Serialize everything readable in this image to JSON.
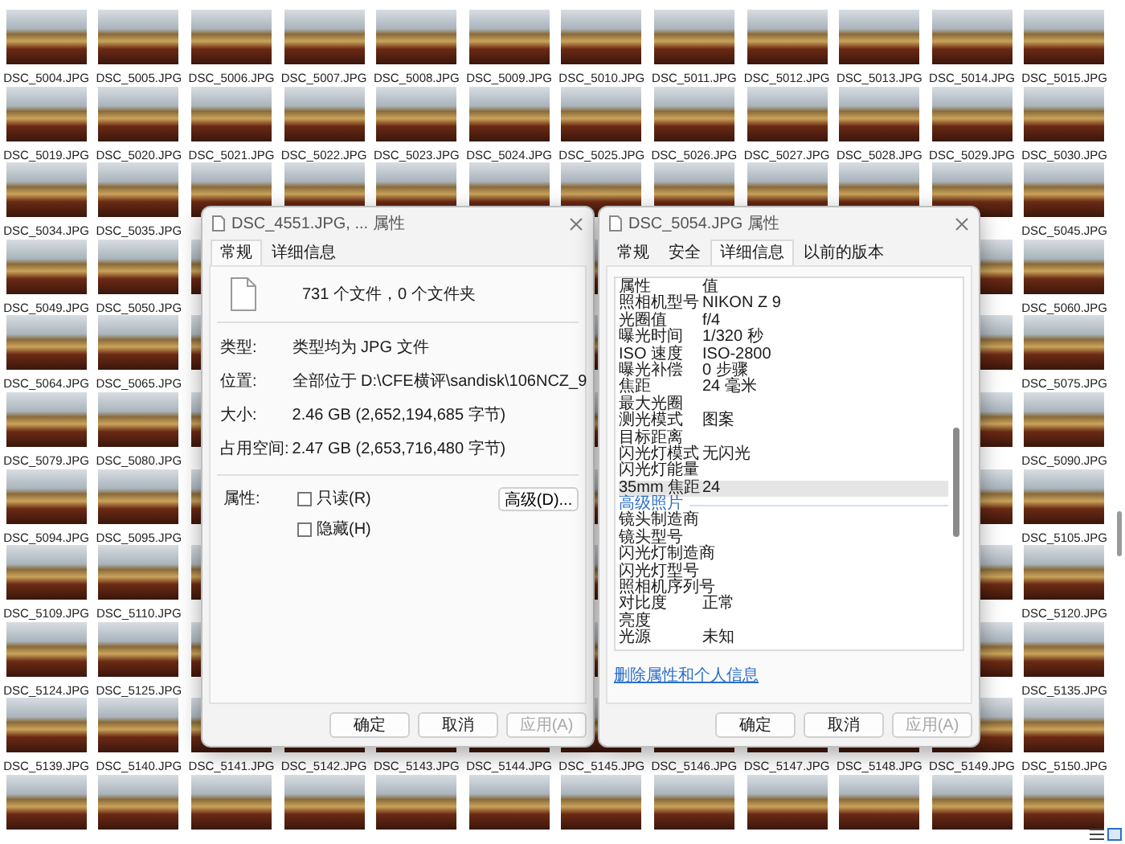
{
  "file_grid": {
    "rows": [
      [
        "DSC_5004.JPG",
        "DSC_5005.JPG",
        "DSC_5006.JPG",
        "DSC_5007.JPG",
        "DSC_5008.JPG",
        "DSC_5009.JPG",
        "DSC_5010.JPG",
        "DSC_5011.JPG",
        "DSC_5012.JPG",
        "DSC_5013.JPG",
        "DSC_5014.JPG",
        "DSC_5015.JPG"
      ],
      [
        "DSC_5019.JPG",
        "DSC_5020.JPG",
        "DSC_5021.JPG",
        "DSC_5022.JPG",
        "DSC_5023.JPG",
        "DSC_5024.JPG",
        "DSC_5025.JPG",
        "DSC_5026.JPG",
        "DSC_5027.JPG",
        "DSC_5028.JPG",
        "DSC_5029.JPG",
        "DSC_5030.JPG"
      ],
      [
        "DSC_5034.JPG",
        "DSC_5035.JPG",
        null,
        null,
        null,
        null,
        null,
        null,
        null,
        null,
        null,
        "DSC_5045.JPG"
      ],
      [
        "DSC_5049.JPG",
        "DSC_5050.JPG",
        null,
        null,
        null,
        null,
        null,
        null,
        null,
        null,
        null,
        "DSC_5060.JPG"
      ],
      [
        "DSC_5064.JPG",
        "DSC_5065.JPG",
        null,
        null,
        null,
        null,
        null,
        null,
        null,
        null,
        null,
        "DSC_5075.JPG"
      ],
      [
        "DSC_5079.JPG",
        "DSC_5080.JPG",
        null,
        null,
        null,
        null,
        null,
        null,
        null,
        null,
        null,
        "DSC_5090.JPG"
      ],
      [
        "DSC_5094.JPG",
        "DSC_5095.JPG",
        null,
        null,
        null,
        null,
        null,
        null,
        null,
        null,
        null,
        "DSC_5105.JPG"
      ],
      [
        "DSC_5109.JPG",
        "DSC_5110.JPG",
        null,
        null,
        null,
        null,
        null,
        null,
        null,
        null,
        null,
        "DSC_5120.JPG"
      ],
      [
        "DSC_5124.JPG",
        "DSC_5125.JPG",
        null,
        null,
        null,
        null,
        null,
        null,
        null,
        null,
        null,
        "DSC_5135.JPG"
      ],
      [
        "DSC_5139.JPG",
        "DSC_5140.JPG",
        "DSC_5141.JPG",
        "DSC_5142.JPG",
        "DSC_5143.JPG",
        "DSC_5144.JPG",
        "DSC_5145.JPG",
        "DSC_5146.JPG",
        "DSC_5147.JPG",
        "DSC_5148.JPG",
        "DSC_5149.JPG",
        "DSC_5150.JPG"
      ],
      [
        null,
        null,
        null,
        null,
        null,
        null,
        null,
        null,
        null,
        null,
        null,
        null
      ]
    ]
  },
  "general_dialog": {
    "title": "DSC_4551.JPG, ... 属性",
    "tabs": [
      {
        "label": "常规",
        "selected": true
      },
      {
        "label": "详细信息",
        "selected": false
      }
    ],
    "summary": "731 个文件，0 个文件夹",
    "fields": [
      {
        "label": "类型:",
        "value": "类型均为 JPG 文件"
      },
      {
        "label": "位置:",
        "value": "全部位于 D:\\CFE横评\\sandisk\\106NCZ_9"
      },
      {
        "label": "大小:",
        "value": "2.46 GB (2,652,194,685 字节)"
      },
      {
        "label": "占用空间:",
        "value": "2.47 GB (2,653,716,480 字节)"
      }
    ],
    "attributes_label": "属性:",
    "checkboxes": [
      {
        "label": "只读(R)",
        "checked": false
      },
      {
        "label": "隐藏(H)",
        "checked": false
      }
    ],
    "advanced_button": "高级(D)...",
    "buttons": [
      {
        "label": "确定",
        "disabled": false
      },
      {
        "label": "取消",
        "disabled": false
      },
      {
        "label": "应用(A)",
        "disabled": true
      }
    ]
  },
  "details_dialog": {
    "title": "DSC_5054.JPG 属性",
    "tabs": [
      {
        "label": "常规",
        "selected": false
      },
      {
        "label": "安全",
        "selected": false
      },
      {
        "label": "详细信息",
        "selected": true
      },
      {
        "label": "以前的版本",
        "selected": false
      }
    ],
    "rows": [
      {
        "kind": "header",
        "property": "属性",
        "value": "值",
        "selected": false
      },
      {
        "kind": "row",
        "property": "照相机型号",
        "value": "NIKON Z 9",
        "selected": false
      },
      {
        "kind": "row",
        "property": "光圈值",
        "value": "f/4",
        "selected": false
      },
      {
        "kind": "row",
        "property": "曝光时间",
        "value": "1/320 秒",
        "selected": false
      },
      {
        "kind": "row",
        "property": "ISO 速度",
        "value": "ISO-2800",
        "selected": false
      },
      {
        "kind": "row",
        "property": "曝光补偿",
        "value": "0 步骤",
        "selected": false
      },
      {
        "kind": "row",
        "property": "焦距",
        "value": "24 毫米",
        "selected": false
      },
      {
        "kind": "row",
        "property": "最大光圈",
        "selected": false
      },
      {
        "kind": "row",
        "property": "测光模式",
        "value": "图案",
        "selected": false
      },
      {
        "kind": "row",
        "property": "目标距离",
        "selected": false
      },
      {
        "kind": "row",
        "property": "闪光灯模式",
        "value": "无闪光",
        "selected": false
      },
      {
        "kind": "row",
        "property": "闪光灯能量",
        "selected": false
      },
      {
        "kind": "row",
        "property": "35mm 焦距",
        "value": "24",
        "selected": true
      },
      {
        "kind": "section",
        "property": "高级照片",
        "selected": false
      },
      {
        "kind": "row",
        "property": "镜头制造商",
        "selected": false
      },
      {
        "kind": "row",
        "property": "镜头型号",
        "selected": false
      },
      {
        "kind": "row",
        "property": "闪光灯制造商",
        "selected": false
      },
      {
        "kind": "row",
        "property": "闪光灯型号",
        "selected": false
      },
      {
        "kind": "row",
        "property": "照相机序列号",
        "selected": false
      },
      {
        "kind": "row",
        "property": "对比度",
        "value": "正常",
        "selected": false
      },
      {
        "kind": "row",
        "property": "亮度",
        "selected": false
      },
      {
        "kind": "row",
        "property": "光源",
        "value": "未知",
        "selected": false
      }
    ],
    "link": "删除属性和个人信息",
    "buttons": [
      {
        "label": "确定",
        "disabled": false
      },
      {
        "label": "取消",
        "disabled": false
      },
      {
        "label": "应用(A)",
        "disabled": true
      }
    ]
  }
}
